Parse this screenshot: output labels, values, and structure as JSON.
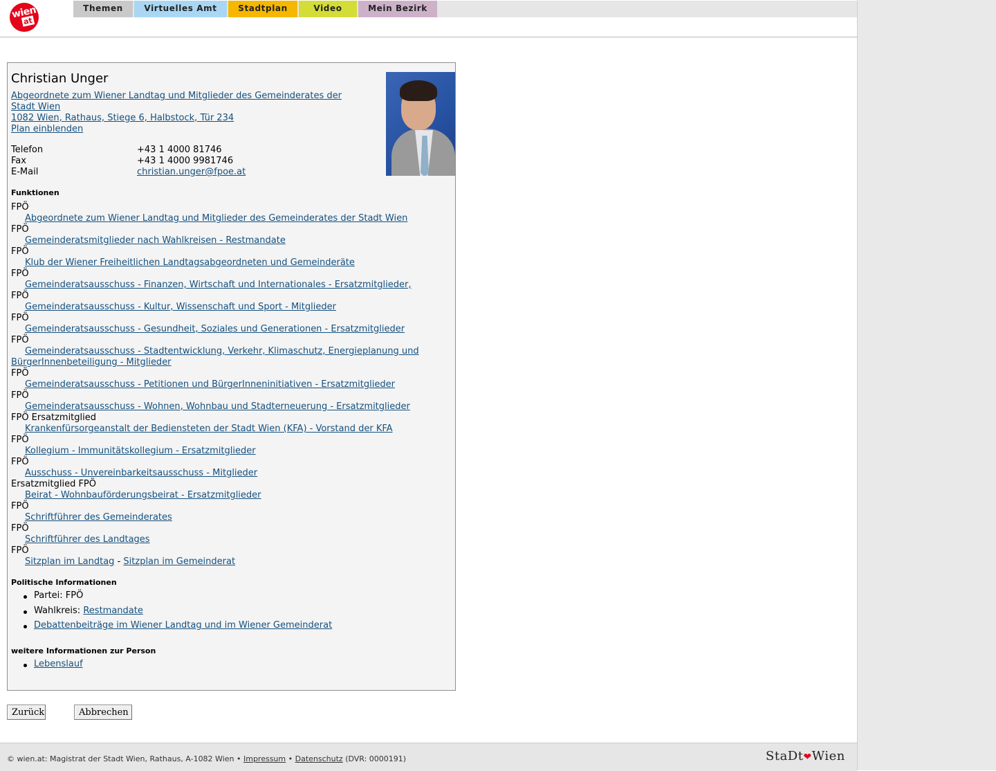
{
  "nav": {
    "logo_main": "wien",
    "logo_sub": "at",
    "tabs": [
      "Themen",
      "Virtuelles Amt",
      "Stadtplan",
      "Video",
      "Mein Bezirk"
    ]
  },
  "person": {
    "name": "Christian Unger",
    "role_link": "Abgeordnete zum Wiener Landtag und Mitglieder des Gemeinderates der",
    "role_link_line2": "Stadt Wien",
    "address_link": "1082 Wien, Rathaus, Stiege 6, Halbstock, Tür 234",
    "plan_link": "Plan einblenden",
    "contacts": {
      "phone_label": "Telefon",
      "phone_value": "+43 1 4000 81746",
      "fax_label": "Fax",
      "fax_value": "+43 1 4000 9981746",
      "email_label": "E-Mail",
      "email_value": "christian.unger@fpoe.at"
    }
  },
  "funktionen": {
    "heading": "Funktionen",
    "items": [
      {
        "party": "FPÖ",
        "link": "Abgeordnete zum Wiener Landtag und Mitglieder des Gemeinderates der Stadt Wien"
      },
      {
        "party": "FPÖ",
        "link": "Gemeinderatsmitglieder nach Wahlkreisen - Restmandate"
      },
      {
        "party": "FPÖ",
        "link": "Klub der Wiener Freiheitlichen Landtagsabgeordneten und Gemeinderäte"
      },
      {
        "party": "FPÖ",
        "link": "Gemeinderatsausschuss - Finanzen, Wirtschaft und Internationales - Ersatzmitglieder, "
      },
      {
        "party": "FPÖ",
        "link": "Gemeinderatsausschuss - Kultur, Wissenschaft und Sport - Mitglieder"
      },
      {
        "party": "FPÖ",
        "link": "Gemeinderatsausschuss - Gesundheit, Soziales und Generationen - Ersatzmitglieder"
      },
      {
        "party": "FPÖ",
        "link": "Gemeinderatsausschuss - Stadtentwicklung, Verkehr, Klimaschutz, Energieplanung und",
        "link_line2": "BürgerInnenbeteiligung - Mitglieder"
      },
      {
        "party": "FPÖ",
        "link": "Gemeinderatsausschuss - Petitionen und BürgerInneninitiativen - Ersatzmitglieder"
      },
      {
        "party": "FPÖ",
        "link": "Gemeinderatsausschuss - Wohnen, Wohnbau und Stadterneuerung - Ersatzmitglieder"
      },
      {
        "party": "FPÖ Ersatzmitglied",
        "link": "Krankenfürsorgeanstalt der Bediensteten der Stadt Wien (KFA) - Vorstand der KFA"
      },
      {
        "party": "FPÖ",
        "link": "Kollegium - Immunitätskollegium - Ersatzmitglieder"
      },
      {
        "party": "FPÖ",
        "link": "Ausschuss - Unvereinbarkeitsausschuss - Mitglieder"
      },
      {
        "party": "Ersatzmitglied FPÖ",
        "link": "Beirat - Wohnbauförderungsbeirat - Ersatzmitglieder"
      },
      {
        "party": "FPÖ",
        "link": "Schriftführer des Gemeinderates"
      },
      {
        "party": "FPÖ",
        "link": "Schriftführer des Landtages"
      },
      {
        "party": "FPÖ",
        "link": "Sitzplan im Landtag",
        "sep": "-",
        "link2": "Sitzplan im Gemeinderat"
      }
    ]
  },
  "politisch": {
    "heading": "Politische Informationen",
    "partei_label": "Partei: FPÖ",
    "wahlkreis_label": "Wahlkreis:",
    "wahlkreis_link": "Restmandate",
    "debatten_link": "Debattenbeiträge im Wiener Landtag und im Wiener Gemeinderat"
  },
  "weitere": {
    "heading": "weitere Informationen zur Person",
    "lebenslauf_link": "Lebenslauf"
  },
  "buttons": {
    "back": "Zurück",
    "cancel": "Abbrechen"
  },
  "footer": {
    "copyright": "© wien.at: Magistrat der Stadt Wien, Rathaus, A-1082 Wien •",
    "impressum": "Impressum",
    "bullet": "•",
    "datenschutz": "Datenschutz",
    "dvr": "(DVR: 0000191)",
    "brand_left": "StaDt",
    "brand_right": "Wien"
  }
}
